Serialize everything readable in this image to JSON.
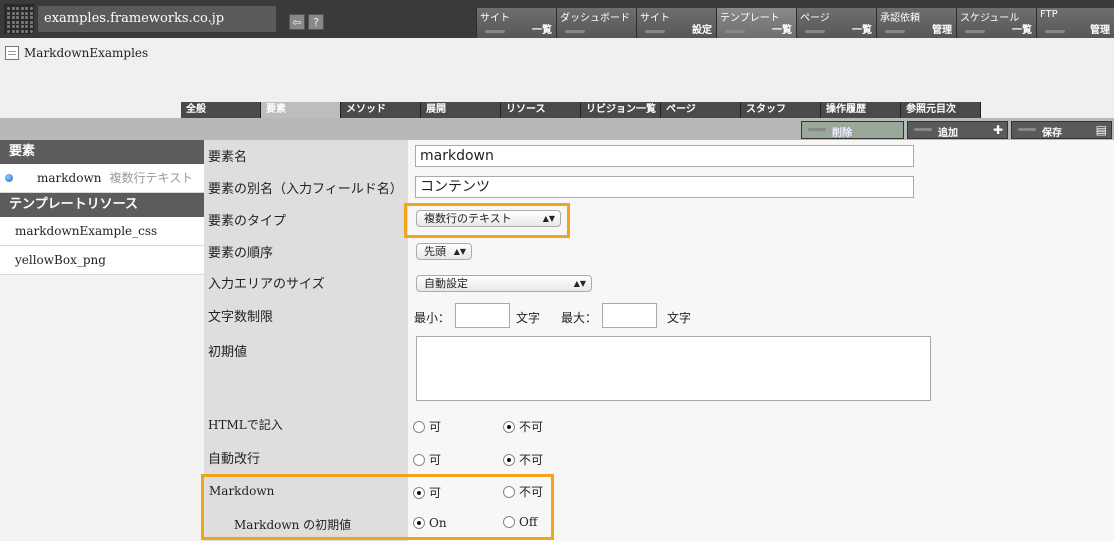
{
  "header": {
    "site_name": "examples.frameworks.co.jp",
    "back_icon": "back-arrow-icon",
    "help_label": "?"
  },
  "topmenu": [
    {
      "top": "サイト",
      "bottom": "一覧"
    },
    {
      "top": "ダッシュボード",
      "bottom": ""
    },
    {
      "top": "サイト",
      "bottom": "設定"
    },
    {
      "top": "テンプレート",
      "bottom": "一覧"
    },
    {
      "top": "ページ",
      "bottom": "一覧"
    },
    {
      "top": "承認依頼",
      "bottom": "管理"
    },
    {
      "top": "スケジュール",
      "bottom": "一覧"
    },
    {
      "top": "FTP",
      "bottom": "管理"
    }
  ],
  "breadcrumb": {
    "label": "MarkdownExamples"
  },
  "tabs": [
    "全般",
    "要素",
    "メソッド",
    "展開",
    "リソース",
    "リビジョン一覧",
    "ページ",
    "スタッフ",
    "操作履歴",
    "参照元目次"
  ],
  "actions": {
    "delete": "削除",
    "add": "追加",
    "save": "保存",
    "add_symbol": "✚"
  },
  "sidebar": {
    "elements_header": "要素",
    "element_name": "markdown",
    "element_type": "複数行テキスト",
    "resources_header": "テンプレートリソース",
    "resources": [
      "markdownExample_css",
      "yellowBox_png"
    ]
  },
  "form": {
    "name_label": "要素名",
    "name_value": "markdown",
    "alias_label": "要素の別名（入力フィールド名）",
    "alias_value": "コンテンツ",
    "type_label": "要素のタイプ",
    "type_value": "複数行のテキスト",
    "order_label": "要素の順序",
    "order_value": "先頭",
    "size_label": "入力エリアのサイズ",
    "size_value": "自動設定",
    "limit_label": "文字数制限",
    "min_label": "最小：",
    "max_label": "最大：",
    "unit": "文字",
    "default_label": "初期値",
    "html_label": "HTMLで記入",
    "autobreak_label": "自動改行",
    "markdown_label": "Markdown",
    "markdown_default_label": "Markdown の初期値",
    "yes": "可",
    "no": "不可",
    "on": "On",
    "off": "Off"
  },
  "colors": {
    "highlight": "#f2a51c"
  }
}
